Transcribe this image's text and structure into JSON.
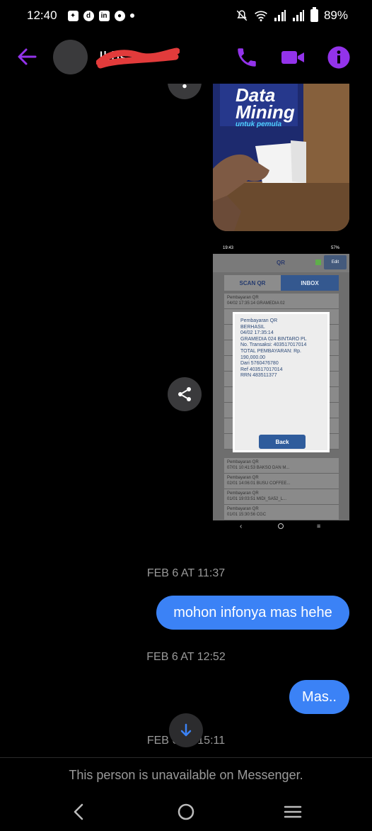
{
  "status_bar": {
    "time": "12:40",
    "battery": "89%"
  },
  "header": {
    "contact_name": "Ikhsan"
  },
  "messages": {
    "photo_book": {
      "title_line1": "Data",
      "title_line2": "Mining",
      "subtitle": "untuk pemula"
    },
    "photo_receipt": {
      "status_time": "19:43",
      "status_battery": "57%",
      "app_title": "QR",
      "edit_label": "Edit",
      "tab_scan": "SCAN QR",
      "tab_inbox": "INBOX",
      "rows": [
        "Pembayaran QR\n04/02 17:35:14 GRAMEDIA 02",
        "Pembayaran QR\n07/01 10:41:53 BAKSO DAN M...",
        "Pembayaran QR\n02/01 14:06:01 BUSU COFFEE...",
        "Pembayaran QR\n01/01 19:03:51 MIDI_SA52_L...",
        "Pembayaran QR\n01/01 15:30:56 CGC"
      ],
      "dialog_text": "Pembayaran QR\nBERHASIL\n04/02 17:35:14\nGRAMEDIA 024 BINTARO PL\nNo. Transaksi: 403517017014\nTOTAL PEMBAYARAN: Rp.\n190,000.00\nDari 5760476780\nRef 403517017014\nRRN 483511377",
      "back_label": "Back"
    },
    "timestamp_1": "FEB 6 AT 11:37",
    "bubble_1": "mohon infonya mas hehe",
    "timestamp_2": "FEB 6 AT 12:52",
    "bubble_2": "Mas..",
    "timestamp_3": "FEB 6 AT 15:11"
  },
  "footer": {
    "unavailable_text": "This person is unavailable on Messenger."
  },
  "colors": {
    "accent_purple": "#9333ea",
    "bubble_blue": "#3b82f6",
    "timestamp_gray": "#9a9a9a"
  },
  "icons": {
    "back": "arrow-left-icon",
    "call": "phone-icon",
    "video": "video-icon",
    "info": "info-icon",
    "share": "share-icon",
    "scroll_down": "arrow-down-icon"
  }
}
